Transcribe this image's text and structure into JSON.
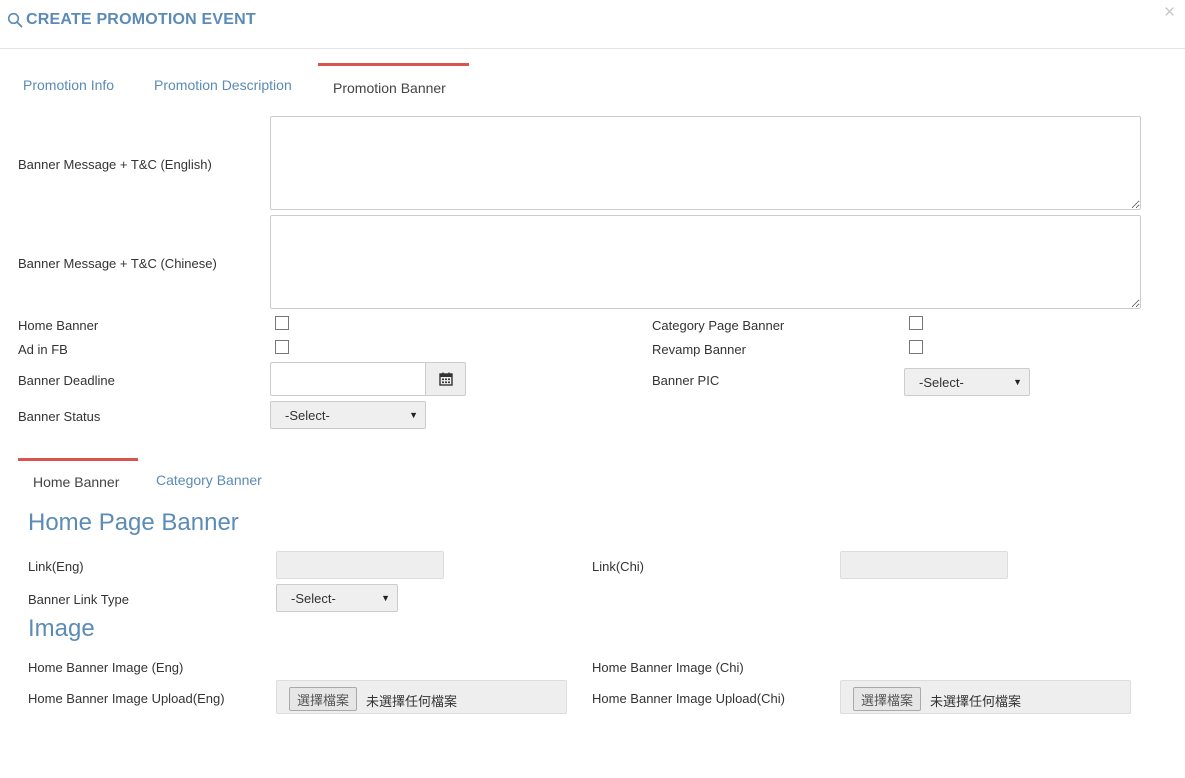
{
  "header": {
    "title": "CREATE PROMOTION EVENT",
    "close_label": "×"
  },
  "tabs": [
    {
      "label": "Promotion Info",
      "active": false
    },
    {
      "label": "Promotion Description",
      "active": false
    },
    {
      "label": "Promotion Banner",
      "active": true
    }
  ],
  "form": {
    "banner_msg_en_label": "Banner Message + T&C (English)",
    "banner_msg_en_value": "",
    "banner_msg_zh_label": "Banner Message + T&C (Chinese)",
    "banner_msg_zh_value": "",
    "home_banner_label": "Home Banner",
    "home_banner_checked": false,
    "category_page_banner_label": "Category Page Banner",
    "category_page_banner_checked": false,
    "ad_in_fb_label": "Ad in FB",
    "ad_in_fb_checked": false,
    "revamp_banner_label": "Revamp Banner",
    "revamp_banner_checked": false,
    "banner_deadline_label": "Banner Deadline",
    "banner_deadline_value": "",
    "banner_pic_label": "Banner PIC",
    "banner_pic_value": "-Select-",
    "banner_status_label": "Banner Status",
    "banner_status_value": "-Select-"
  },
  "sub_tabs": [
    {
      "label": "Home Banner",
      "active": true
    },
    {
      "label": "Category Banner",
      "active": false
    }
  ],
  "home_page_banner": {
    "section_title": "Home Page Banner",
    "link_eng_label": "Link(Eng)",
    "link_eng_value": "",
    "link_chi_label": "Link(Chi)",
    "link_chi_value": "",
    "link_type_label": "Banner Link Type",
    "link_type_value": "-Select-"
  },
  "image": {
    "section_title": "Image",
    "image_eng_label": "Home Banner Image (Eng)",
    "image_chi_label": "Home Banner Image (Chi)",
    "upload_eng_label": "Home Banner Image Upload(Eng)",
    "upload_chi_label": "Home Banner Image Upload(Chi)",
    "choose_file_label": "選擇檔案",
    "no_file_text": "未選擇任何檔案"
  },
  "colors": {
    "accent": "#5b8bb6",
    "active_tab_border": "#d9534f",
    "input_bg": "#eeeeee"
  },
  "icons": {
    "title": "search-icon",
    "close": "close-icon",
    "date": "calendar-icon",
    "select": "caret-down-icon"
  }
}
